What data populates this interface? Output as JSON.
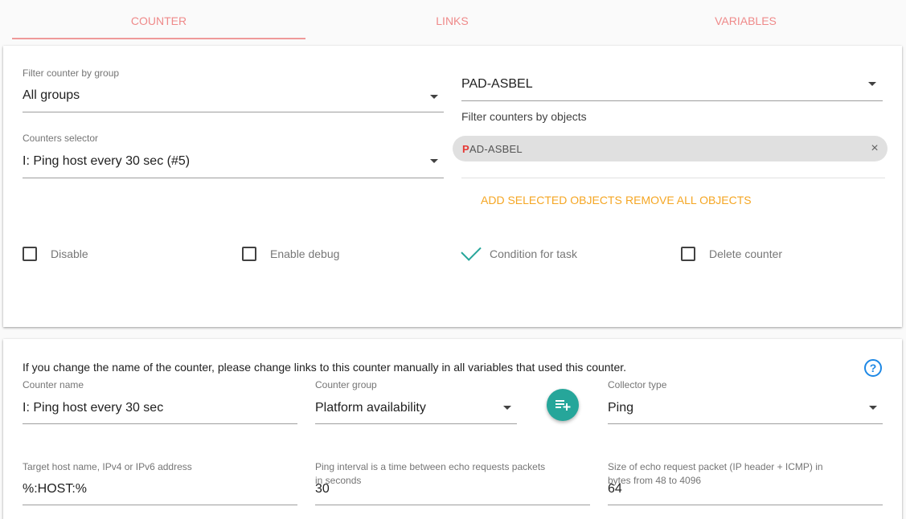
{
  "tabs": [
    {
      "label": "COUNTER"
    },
    {
      "label": "LINKS"
    },
    {
      "label": "VARIABLES"
    }
  ],
  "filter_group": {
    "label": "Filter counter by group",
    "value": "All groups"
  },
  "counters_selector": {
    "label": "Counters selector",
    "value": "I: Ping host every 30 sec (#5)"
  },
  "objects_select": {
    "value": "PAD-ASBEL",
    "helper": "Filter counters by objects"
  },
  "chip": {
    "first_letter": "P",
    "rest": "AD-ASBEL",
    "close": "×"
  },
  "object_buttons": {
    "add": "ADD SELECTED OBJECTS",
    "remove": "REMOVE ALL OBJECTS"
  },
  "checkboxes": [
    {
      "label": "Disable",
      "checked": false
    },
    {
      "label": "Enable debug",
      "checked": false
    },
    {
      "label": "Condition for task",
      "checked": true
    },
    {
      "label": "Delete counter",
      "checked": false
    }
  ],
  "notice": "If you change the name of the counter, please change links to this counter manually in all variables that used this counter.",
  "help": "?",
  "counter_name": {
    "label": "Counter name",
    "value": "I: Ping host every 30 sec"
  },
  "counter_group": {
    "label": "Counter group",
    "value": "Platform availability"
  },
  "collector_type": {
    "label": "Collector type",
    "value": "Ping"
  },
  "target_host": {
    "label": "Target host name, IPv4 or IPv6 address",
    "value": "%:HOST:%"
  },
  "ping_interval": {
    "label_line1": "Ping interval is a time between echo requests packets",
    "label_line2": "in seconds",
    "value": "30"
  },
  "packet_size": {
    "label_line1": "Size of echo request packet (IP header + ICMP) in",
    "label_line2": "bytes from 48 to 4096",
    "value": "64"
  },
  "colors": {
    "accent": "#26a69a",
    "tab": "#ef8a8a",
    "button": "#f5a623",
    "help": "#1e88e5"
  }
}
